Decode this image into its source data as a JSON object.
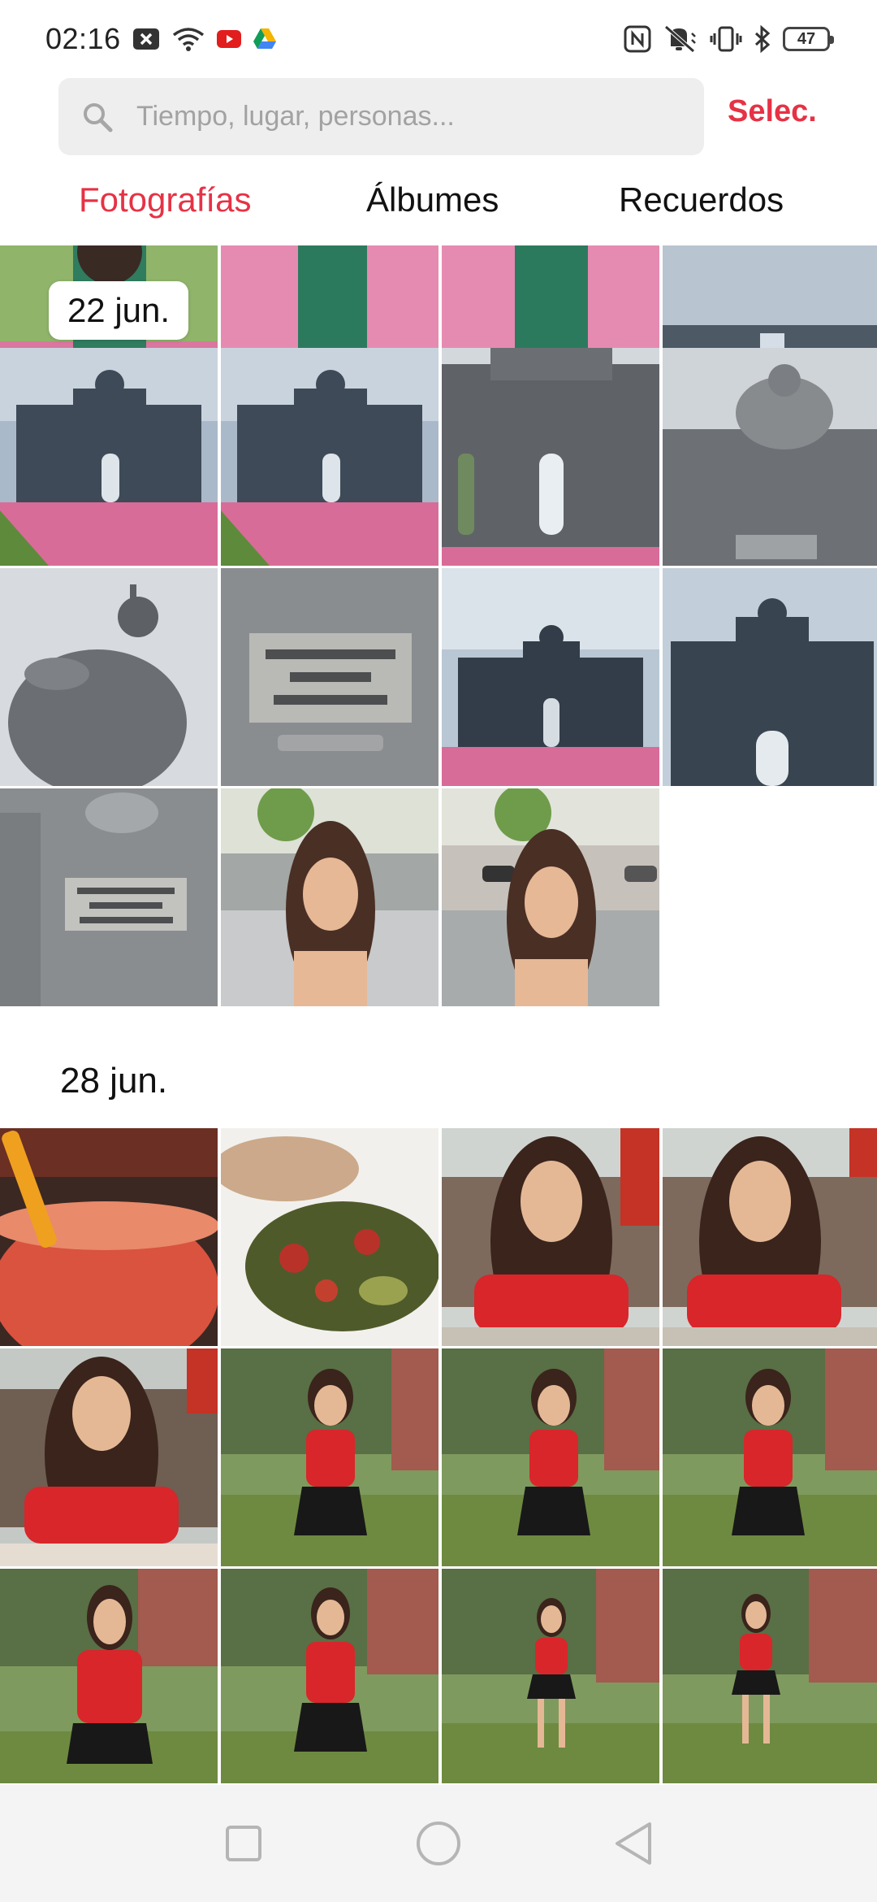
{
  "status": {
    "time": "02:16",
    "battery": "47",
    "left_icons": [
      "close-box-icon",
      "wifi-icon",
      "youtube-icon",
      "drive-icon"
    ],
    "right_icons": [
      "nfc-icon",
      "vibrate-off-icon",
      "vibrate-icon",
      "bluetooth-icon",
      "battery-icon"
    ]
  },
  "search": {
    "placeholder": "Tiempo, lugar, personas...",
    "select_label": "Selec."
  },
  "tabs": [
    {
      "label": "Fotografías",
      "active": true
    },
    {
      "label": "Álbumes",
      "active": false
    },
    {
      "label": "Recuerdos",
      "active": false
    }
  ],
  "sections": [
    {
      "date": "22 jun.",
      "photo_count": 15
    },
    {
      "date": "28 jun.",
      "photo_count": 12
    }
  ],
  "colors": {
    "accent": "#e63245"
  },
  "nav": [
    "recents-button",
    "home-button",
    "back-button"
  ]
}
